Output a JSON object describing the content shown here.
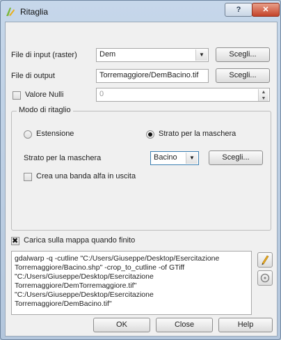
{
  "window": {
    "title": "Ritaglia",
    "help_label": "?"
  },
  "input_raster": {
    "label": "File di input (raster)",
    "value": "Dem",
    "browse_label": "Scegli..."
  },
  "output_file": {
    "label": "File di output",
    "value": "Torremaggiore/DemBacino.tif",
    "browse_label": "Scegli..."
  },
  "nodata": {
    "label": "Valore Nulli",
    "value": "0",
    "checked": false
  },
  "clip_mode": {
    "title": "Modo di ritaglio",
    "extent_label": "Estensione",
    "mask_layer_radio_label": "Strato per la maschera",
    "selected": "mask",
    "mask_layer_label": "Strato per la maschera",
    "mask_layer_value": "Bacino",
    "browse_label": "Scegli...",
    "alpha_label": "Crea una banda alfa in uscita"
  },
  "load_in_canvas": {
    "label": "Carica sulla mappa quando finito",
    "checked": true
  },
  "command": {
    "text": "gdalwarp -q -cutline \"C:/Users/Giuseppe/Desktop/Esercitazione\nTorremaggiore/Bacino.shp\" -crop_to_cutline -of GTiff\n\"C:/Users/Giuseppe/Desktop/Esercitazione\nTorremaggiore/DemTorremaggiore.tif\"\n\"C:/Users/Giuseppe/Desktop/Esercitazione\nTorremaggiore/DemBacino.tif\""
  },
  "footer": {
    "ok_label": "OK",
    "close_label": "Close",
    "help_label": "Help"
  },
  "colors": {
    "title_bar": "#c6d7ea",
    "close_button": "#c4432a",
    "dialog_bg": "#f0f0f0"
  },
  "icons": {
    "app": "qgis-clip-icon",
    "edit": "pencil-icon",
    "reset": "reset-icon"
  }
}
